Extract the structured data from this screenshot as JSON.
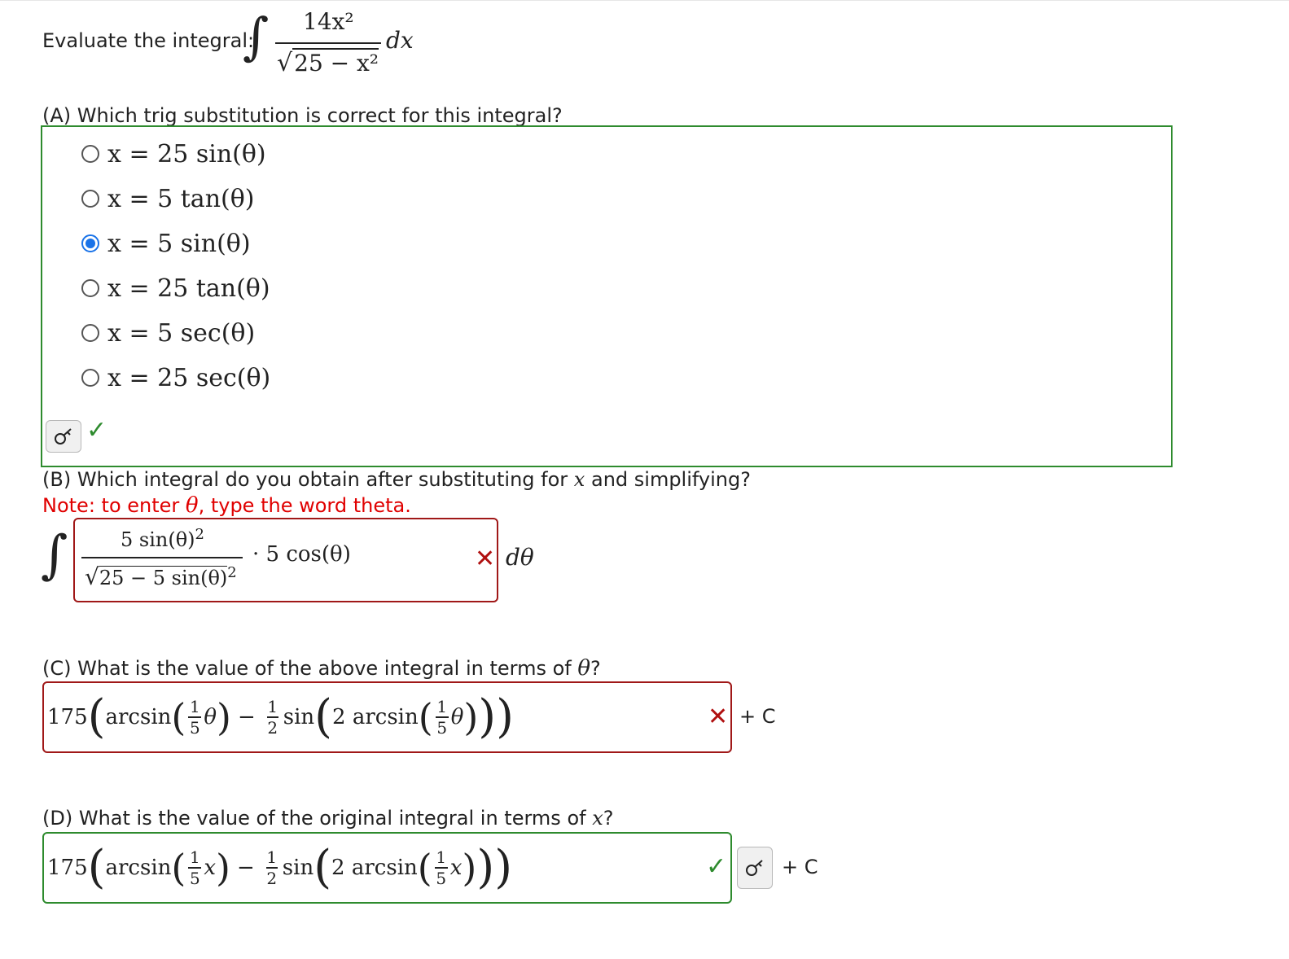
{
  "header": {
    "prompt": "Evaluate the integral:",
    "integral_sign": "∫",
    "numerator": "14x²",
    "denominator_radicand": "25 − x²",
    "differential": "dx"
  },
  "part_a": {
    "question": "(A) Which trig substitution is correct for this integral?",
    "options": [
      {
        "label": "x = 25 sin(θ)",
        "checked": false
      },
      {
        "label": "x = 5 tan(θ)",
        "checked": false
      },
      {
        "label": "x = 5 sin(θ)",
        "checked": true
      },
      {
        "label": "x = 25 tan(θ)",
        "checked": false
      },
      {
        "label": "x = 5 sec(θ)",
        "checked": false
      },
      {
        "label": "x = 25 sec(θ)",
        "checked": false
      }
    ],
    "status": "correct",
    "box_color": "#2e8b2e"
  },
  "part_b": {
    "question_prefix": "(B) Which integral do you obtain after substituting for",
    "question_var": "x",
    "question_suffix": "and simplifying?",
    "note_prefix": "Note: to enter",
    "note_symbol": "θ",
    "note_suffix": ", type the word theta.",
    "note_color": "#e00000",
    "answer": {
      "numerator": "5 sin(θ)",
      "numerator_exp": "2",
      "denominator_radicand": "25 − 5 sin(θ)",
      "denominator_exp": "2",
      "factor": "· 5 cos(θ)"
    },
    "differential": "dθ",
    "status": "incorrect",
    "box_color": "#a01818"
  },
  "part_c": {
    "question_prefix": "(C) What is the value of the above integral in terms of",
    "question_var": "θ",
    "question_suffix": "?",
    "answer": {
      "coef": "175",
      "arcsin": "arcsin",
      "frac_num": "1",
      "frac_den": "5",
      "var": "θ",
      "minus": "−",
      "half_num": "1",
      "half_den": "2",
      "sin": "sin",
      "two_arcsin": "2 arcsin"
    },
    "suffix": "+ C",
    "status": "incorrect",
    "box_color": "#a01818"
  },
  "part_d": {
    "question_prefix": "(D) What is the value of the original integral in terms of",
    "question_var": "x",
    "question_suffix": "?",
    "answer": {
      "coef": "175",
      "arcsin": "arcsin",
      "frac_num": "1",
      "frac_den": "5",
      "var": "x",
      "minus": "−",
      "half_num": "1",
      "half_den": "2",
      "sin": "sin",
      "two_arcsin": "2 arcsin"
    },
    "suffix": "+ C",
    "status": "correct",
    "box_color": "#2e8b2e"
  },
  "icons": {
    "key": "key-icon",
    "check": "✓",
    "cross": "✕"
  }
}
